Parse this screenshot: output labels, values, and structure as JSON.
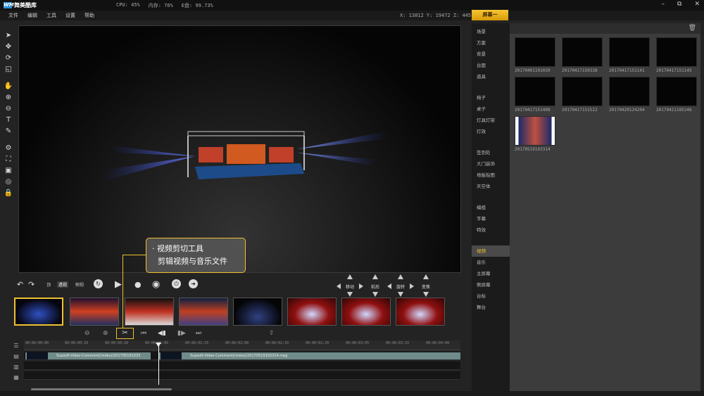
{
  "app": {
    "name": "舞美酷库",
    "logo_text": "WM"
  },
  "stats": {
    "cpu": "CPU: 45%",
    "mem": "内存: 76%",
    "disk": "E盘: 99.73%"
  },
  "window_controls": {
    "minimize": "–",
    "maximize": "⧉",
    "close": "✕"
  },
  "menu": [
    "文件",
    "编辑",
    "工具",
    "设置",
    "帮助"
  ],
  "coords": "X: 13812  Y: 19472  Z: 4451",
  "screen_tab": "屏幕一",
  "tools": [
    "select-arrow",
    "move",
    "rotate",
    "scale",
    "pan-hand",
    "zoom-in",
    "zoom-out",
    "text",
    "edit",
    "settings",
    "fit",
    "camera",
    "sphere",
    "lock"
  ],
  "controls": {
    "undo": "↶",
    "redo": "↷",
    "views": [
      "顶",
      "透视",
      "侧视"
    ],
    "active_view": "透视",
    "play": "▶",
    "record": "●",
    "eye": "◉",
    "power": "⏻",
    "next": "➜",
    "arrow_groups": [
      "移动",
      "前后",
      "旋转",
      "变焦"
    ]
  },
  "callout": {
    "line1": "· 视频剪切工具",
    "line2": "剪辑视频与音乐文件"
  },
  "timeline": {
    "ticks": [
      "00:00:00:00",
      "00:00:00:10",
      "00:00:00:20",
      "00:00:01:05",
      "00:00:01:15",
      "00:00:02:00",
      "00:00:02:10",
      "00:00:02:20",
      "00:00:03:05",
      "00:00:03:15",
      "00:00:04:00"
    ],
    "clip1": "Supsoft-Video-Comment//video//201705191033",
    "clip2": "Supsoft-Video-Comment//video//20170519103314.mpg"
  },
  "sidebar": {
    "groups": [
      [
        "场景",
        "方案",
        "背景",
        "台面",
        "道具"
      ],
      [
        "椅子",
        "桌子",
        "灯具灯架",
        "灯效"
      ],
      [
        "签到处",
        "大门装饰",
        "地板贴图",
        "天空体"
      ],
      [
        "编组",
        "字幕",
        "特效"
      ],
      [
        "视频",
        "音乐",
        "主屏幕",
        "侧屏幕",
        "台标",
        "舞台"
      ]
    ],
    "active": "视频"
  },
  "gallery": [
    "20170401191020",
    "20170417150338",
    "20170417151141",
    "20170417151145",
    "20170417151408",
    "20170417151522",
    "20170420124204",
    "20170421185246",
    "20170519103314"
  ],
  "colors": {
    "accent": "#f0c030",
    "panel": "#3c3c3c",
    "clip": "#6f8b8a"
  }
}
